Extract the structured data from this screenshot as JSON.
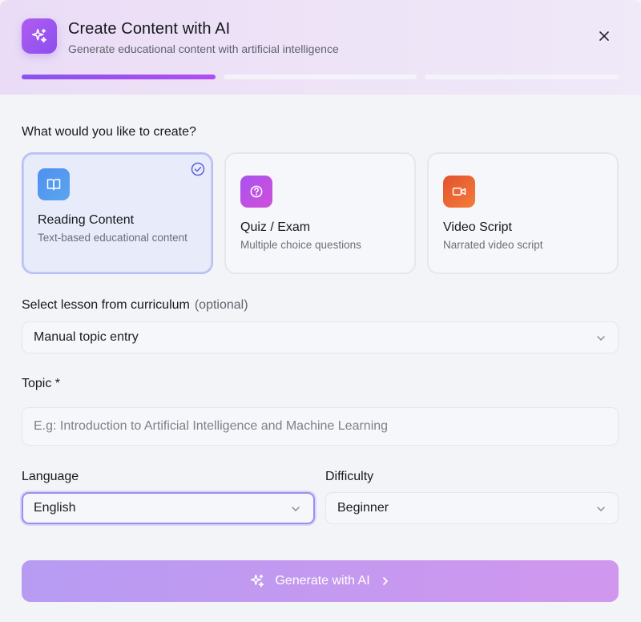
{
  "header": {
    "title": "Create Content with AI",
    "subtitle": "Generate educational content with artificial intelligence",
    "progress_steps": [
      {
        "state": "active",
        "fill": 1.0
      },
      {
        "state": "inactive",
        "fill": 0.0
      },
      {
        "state": "inactive",
        "fill": 0.0
      }
    ]
  },
  "content_type": {
    "label": "What would you like to create?",
    "options": [
      {
        "title": "Reading Content",
        "description": "Text-based educational content",
        "icon": "book-icon",
        "selected": true,
        "color": "#4f8ff0"
      },
      {
        "title": "Quiz / Exam",
        "description": "Multiple choice questions",
        "icon": "question-circle-icon",
        "selected": false,
        "color": "#c04fe6"
      },
      {
        "title": "Video Script",
        "description": "Narrated video script",
        "icon": "video-camera-icon",
        "selected": false,
        "color": "#ef6a34"
      }
    ]
  },
  "lesson": {
    "label": "Select lesson from curriculum",
    "optional": "(optional)",
    "value": "Manual topic entry"
  },
  "topic": {
    "label": "Topic *",
    "placeholder": "E.g: Introduction to Artificial Intelligence and Machine Learning",
    "value": ""
  },
  "language": {
    "label": "Language",
    "value": "English"
  },
  "difficulty": {
    "label": "Difficulty",
    "value": "Beginner"
  },
  "generate": {
    "label": "Generate with AI"
  },
  "colors": {
    "accent": "#8b4ff0",
    "button_start": "#b79bf2",
    "button_end": "#d197ee"
  }
}
